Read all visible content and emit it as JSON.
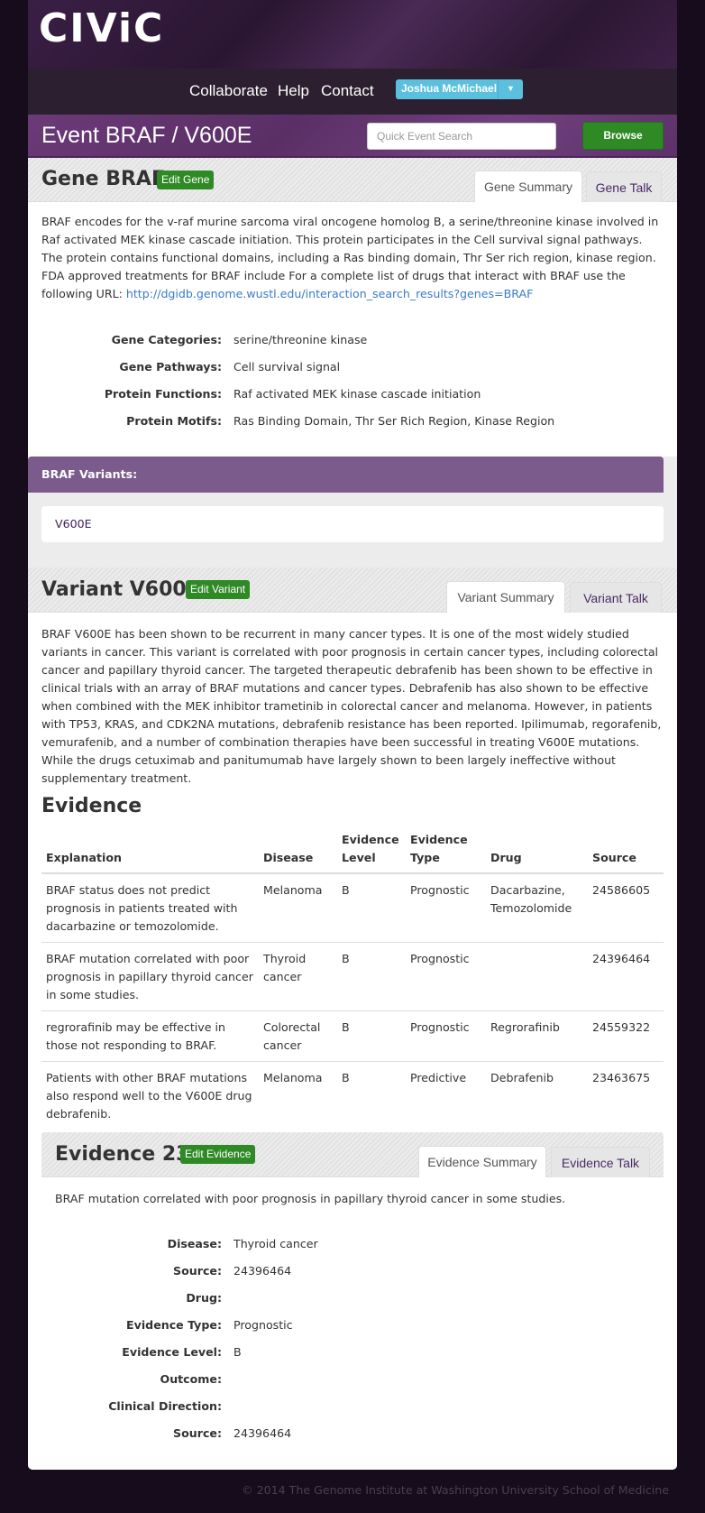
{
  "header": {
    "logo": "CIViC",
    "nav": [
      "Collaborate",
      "Help",
      "Contact"
    ],
    "user": "Joshua McMichael"
  },
  "event_bar": {
    "title": "Event BRAF / V600E",
    "search_placeholder": "Quick Event Search",
    "browse_label": "Browse"
  },
  "gene": {
    "title": "Gene BRAF",
    "edit_label": "Edit Gene",
    "tabs": [
      "Gene Summary",
      "Gene Talk"
    ],
    "description": "BRAF encodes for the v-raf murine sarcoma viral oncogene homolog B, a serine/threonine kinase involved in Raf activated MEK kinase cascade initiation. This protein participates in the Cell survival signal pathways. The protein contains functional domains, including a Ras binding domain, Thr Ser rich region, kinase region. FDA approved treatments for BRAF include For a complete list of drugs that interact with BRAF use the following URL: ",
    "link": "http://dgidb.genome.wustl.edu/interaction_search_results?genes=BRAF",
    "details": [
      {
        "label": "Gene Categories:",
        "value": "serine/threonine kinase"
      },
      {
        "label": "Gene Pathways:",
        "value": "Cell survival signal"
      },
      {
        "label": "Protein Functions:",
        "value": "Raf activated MEK kinase cascade initiation"
      },
      {
        "label": "Protein Motifs:",
        "value": "Ras Binding Domain, Thr Ser Rich Region, Kinase Region"
      }
    ],
    "variants_header": "BRAF Variants:",
    "variants": [
      "V600E"
    ]
  },
  "variant": {
    "title": "Variant V600E",
    "edit_label": "Edit Variant",
    "tabs": [
      "Variant Summary",
      "Variant Talk"
    ],
    "description": "BRAF V600E has been shown to be recurrent in many cancer types. It is one of the most widely studied variants in cancer. This variant is correlated with poor prognosis in certain cancer types, including colorectal cancer and papillary thyroid cancer. The targeted therapeutic debrafenib has been shown to be effective in clinical trials with an array of BRAF mutations and cancer types. Debrafenib has also shown to be effective when combined with the MEK inhibitor trametinib in colorectal cancer and melanoma. However, in patients with TP53, KRAS, and CDK2NA mutations, debrafenib resistance has been reported. Ipilimumab, regorafenib, vemurafenib, and a number of combination therapies have been successful in treating V600E mutations. While the drugs cetuximab and panitumumab have largely shown to been largely ineffective without supplementary treatment."
  },
  "evidence": {
    "heading": "Evidence",
    "columns": [
      "Explanation",
      "Disease",
      "Evidence Level",
      "Evidence Type",
      "Drug",
      "Source"
    ],
    "rows": [
      [
        "BRAF status does not predict prognosis in patients treated with dacarbazine or temozolomide.",
        "Melanoma",
        "B",
        "Prognostic",
        "Dacarbazine, Temozolomide",
        "24586605"
      ],
      [
        "BRAF mutation correlated with poor prognosis in papillary thyroid cancer in some studies.",
        "Thyroid cancer",
        "B",
        "Prognostic",
        "",
        "24396464"
      ],
      [
        "regrorafinib may be effective in those not responding to BRAF.",
        "Colorectal cancer",
        "B",
        "Prognostic",
        "Regrorafinib",
        "24559322"
      ],
      [
        "Patients with other BRAF mutations also respond well to the V600E drug debrafenib.",
        "Melanoma",
        "B",
        "Predictive",
        "Debrafenib",
        "23463675"
      ]
    ]
  },
  "evidence_item": {
    "title": "Evidence 23",
    "edit_label": "Edit Evidence",
    "tabs": [
      "Evidence Summary",
      "Evidence Talk"
    ],
    "description": "BRAF mutation correlated with poor prognosis in papillary thyroid cancer in some studies.",
    "details": [
      {
        "label": "Disease:",
        "value": "Thyroid cancer"
      },
      {
        "label": "Source:",
        "value": "24396464"
      },
      {
        "label": "Drug:",
        "value": ""
      },
      {
        "label": "Evidence Type:",
        "value": "Prognostic"
      },
      {
        "label": "Evidence Level:",
        "value": "B"
      },
      {
        "label": "Outcome:",
        "value": ""
      },
      {
        "label": "Clinical Direction:",
        "value": ""
      },
      {
        "label": "Source:",
        "value": "24396464"
      }
    ]
  },
  "footer": "© 2014 The Genome Institute at Washington University School of Medicine"
}
